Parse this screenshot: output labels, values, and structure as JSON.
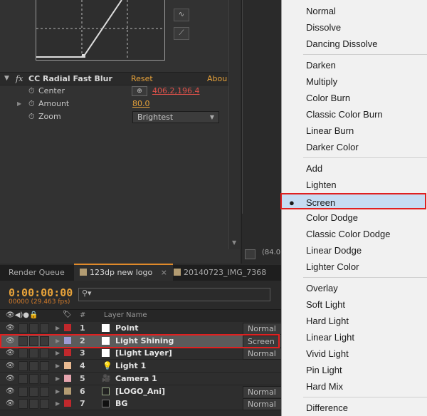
{
  "effect": {
    "name": "CC Radial Fast Blur",
    "reset": "Reset",
    "about": "Abou",
    "props": [
      {
        "label": "Center",
        "value": "406.2,196.4"
      },
      {
        "label": "Amount",
        "value": "80.0"
      },
      {
        "label": "Zoom",
        "value": "Brightest"
      }
    ]
  },
  "viewer": {
    "zoom": "(84.0"
  },
  "timeline": {
    "tabs": [
      "Render Queue",
      "123dp new logo",
      "20140723_IMG_7368"
    ],
    "timecode": "0:00:00:00",
    "fps": "00000 (29.463 fps)",
    "header": {
      "num": "#",
      "layer_name": "Layer Name"
    },
    "layers": [
      {
        "num": "1",
        "name": "Point",
        "mode": "Normal",
        "label_color": "#c0282c",
        "src": "solid"
      },
      {
        "num": "2",
        "name": "Light Shining",
        "mode": "Screen",
        "label_color": "#9d9bd6",
        "src": "solid"
      },
      {
        "num": "3",
        "name": "[Light Layer]",
        "mode": "Normal",
        "label_color": "#c0282c",
        "src": "solid"
      },
      {
        "num": "4",
        "name": "Light 1",
        "mode": "",
        "label_color": "#e8b991",
        "src": "light"
      },
      {
        "num": "5",
        "name": "Camera 1",
        "mode": "",
        "label_color": "#e5a4ae",
        "src": "camera"
      },
      {
        "num": "6",
        "name": "[LOGO_Ani]",
        "mode": "Normal",
        "label_color": "#b49c73",
        "src": "comp"
      },
      {
        "num": "7",
        "name": "BG",
        "mode": "Normal",
        "label_color": "#c0282c",
        "src": "solid-dark"
      }
    ]
  },
  "blend_menu": {
    "selected": "Screen",
    "groups": [
      [
        "Normal",
        "Dissolve",
        "Dancing Dissolve"
      ],
      [
        "Darken",
        "Multiply",
        "Color Burn",
        "Classic Color Burn",
        "Linear Burn",
        "Darker Color"
      ],
      [
        "Add",
        "Lighten",
        "Screen",
        "Color Dodge",
        "Classic Color Dodge",
        "Linear Dodge",
        "Lighter Color"
      ],
      [
        "Overlay",
        "Soft Light",
        "Hard Light",
        "Linear Light",
        "Vivid Light",
        "Pin Light",
        "Hard Mix"
      ],
      [
        "Difference"
      ]
    ]
  }
}
